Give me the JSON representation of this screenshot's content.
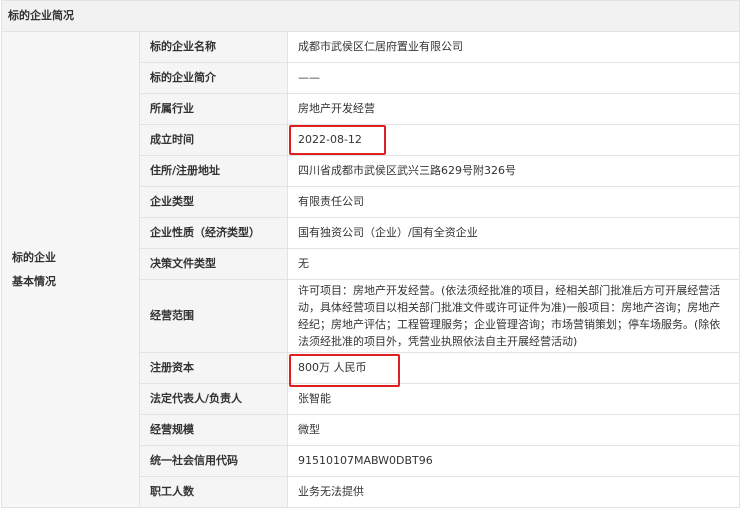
{
  "section_title": "标的企业简况",
  "group_label_line1": "标的企业",
  "group_label_line2": "基本情况",
  "rows": [
    {
      "label": "标的企业名称",
      "value": "成都市武侯区仁居府置业有限公司"
    },
    {
      "label": "标的企业简介",
      "value": "——"
    },
    {
      "label": "所属行业",
      "value": "房地产开发经营"
    },
    {
      "label": "成立时间",
      "value": "2022-08-12"
    },
    {
      "label": "住所/注册地址",
      "value": "四川省成都市武侯区武兴三路629号附326号"
    },
    {
      "label": "企业类型",
      "value": "有限责任公司"
    },
    {
      "label": "企业性质（经济类型）",
      "value": "国有独资公司（企业）/国有全资企业"
    },
    {
      "label": "决策文件类型",
      "value": "无"
    },
    {
      "label": "经营范围",
      "value": "许可项目：房地产开发经营。(依法须经批准的项目，经相关部门批准后方可开展经营活动，具体经营项目以相关部门批准文件或许可证件为准)一般项目：房地产咨询；房地产经纪；房地产评估；工程管理服务；企业管理咨询；市场营销策划；停车场服务。(除依法须经批准的项目外，凭营业执照依法自主开展经营活动)"
    },
    {
      "label": "注册资本",
      "value": "800万 人民币"
    },
    {
      "label": "法定代表人/负责人",
      "value": "张智能"
    },
    {
      "label": "经营规模",
      "value": "微型"
    },
    {
      "label": "统一社会信用代码",
      "value": "91510107MABW0DBT96"
    },
    {
      "label": "职工人数",
      "value": "业务无法提供"
    }
  ],
  "highlight_color": "#e02020"
}
